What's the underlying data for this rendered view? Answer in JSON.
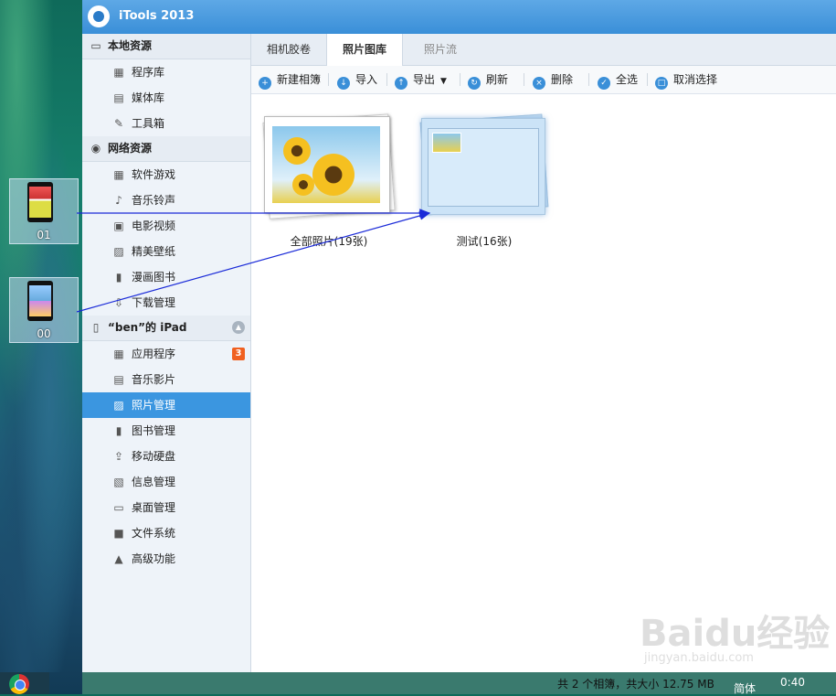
{
  "app": {
    "title": "iTools 2013"
  },
  "desktop": {
    "icons": [
      {
        "label": "01"
      },
      {
        "label": "00"
      }
    ]
  },
  "sidebar": {
    "sections": [
      {
        "title": "本地资源",
        "items": [
          {
            "label": "程序库"
          },
          {
            "label": "媒体库"
          },
          {
            "label": "工具箱"
          }
        ]
      },
      {
        "title": "网络资源",
        "items": [
          {
            "label": "软件游戏"
          },
          {
            "label": "音乐铃声"
          },
          {
            "label": "电影视频"
          },
          {
            "label": "精美壁纸"
          },
          {
            "label": "漫画图书"
          },
          {
            "label": "下载管理"
          }
        ]
      },
      {
        "title": "“ben”的 iPad",
        "items": [
          {
            "label": "应用程序",
            "badge": "3"
          },
          {
            "label": "音乐影片"
          },
          {
            "label": "照片管理"
          },
          {
            "label": "图书管理"
          },
          {
            "label": "移动硬盘"
          },
          {
            "label": "信息管理"
          },
          {
            "label": "桌面管理"
          },
          {
            "label": "文件系统"
          },
          {
            "label": "高级功能"
          }
        ]
      }
    ]
  },
  "tabs": [
    {
      "label": "相机胶卷"
    },
    {
      "label": "照片图库"
    },
    {
      "label": "照片流"
    }
  ],
  "toolbar": {
    "new_album": "新建相簿",
    "import": "导入",
    "export": "导出",
    "refresh": "刷新",
    "delete": "删除",
    "select_all": "全选",
    "deselect": "取消选择"
  },
  "albums": [
    {
      "label": "全部照片(19张)"
    },
    {
      "label": "测试(16张)"
    }
  ],
  "status": {
    "text": "共 2 个相簿，共大小 12.75 MB",
    "ime": "简体",
    "time": "0:40"
  },
  "watermark": {
    "line1": "Baidu经验",
    "line2": "jingyan.baidu.com"
  },
  "colors": {
    "accent": "#3b96e0",
    "badge": "#f06020"
  }
}
